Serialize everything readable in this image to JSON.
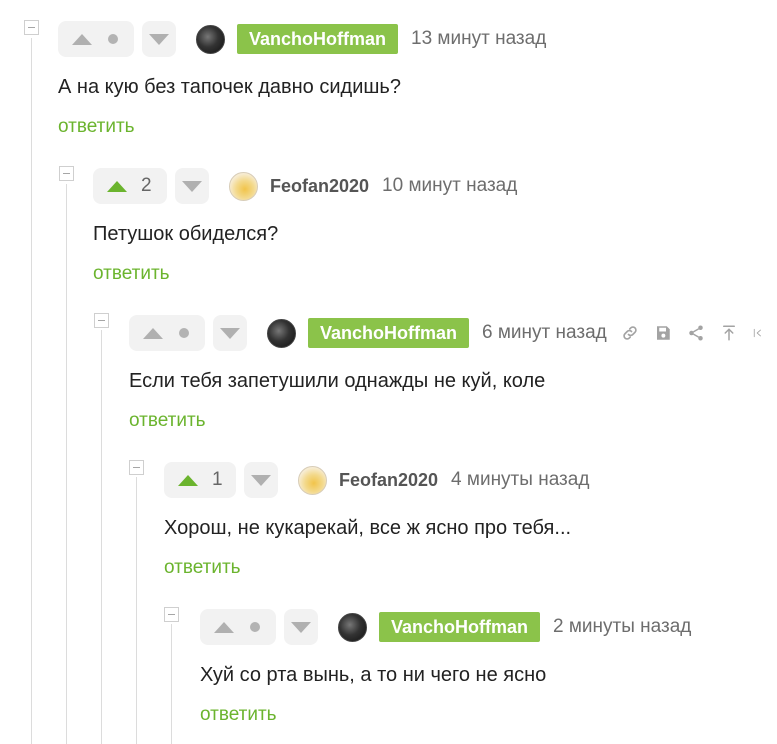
{
  "comments": [
    {
      "author": "VanchoHoffman",
      "time": "13 минут назад",
      "score": "",
      "text": "А на кую без тапочек давно сидишь?",
      "reply": "ответить"
    },
    {
      "author": "Feofan2020",
      "time": "10 минут назад",
      "score": "2",
      "text": "Петушок обиделся?",
      "reply": "ответить"
    },
    {
      "author": "VanchoHoffman",
      "time": "6 минут назад",
      "score": "",
      "text": "Если тебя запетушили однажды не куй, коле",
      "reply": "ответить",
      "actions": [
        "link-icon",
        "save-icon",
        "share-icon",
        "scroll-up-icon",
        "collapse-icon"
      ]
    },
    {
      "author": "Feofan2020",
      "time": "4 минуты назад",
      "score": "1",
      "text": "Хорош, не кукарекай, все ж ясно про тебя...",
      "reply": "ответить"
    },
    {
      "author": "VanchoHoffman",
      "time": "2 минуты назад",
      "score": "",
      "text": "Хуй со рта вынь, а то ни чего не ясно",
      "reply": "ответить"
    }
  ],
  "colors": {
    "accent": "#8bc34a",
    "reply": "#6bb42e",
    "upvoted": "#6bb42e"
  }
}
